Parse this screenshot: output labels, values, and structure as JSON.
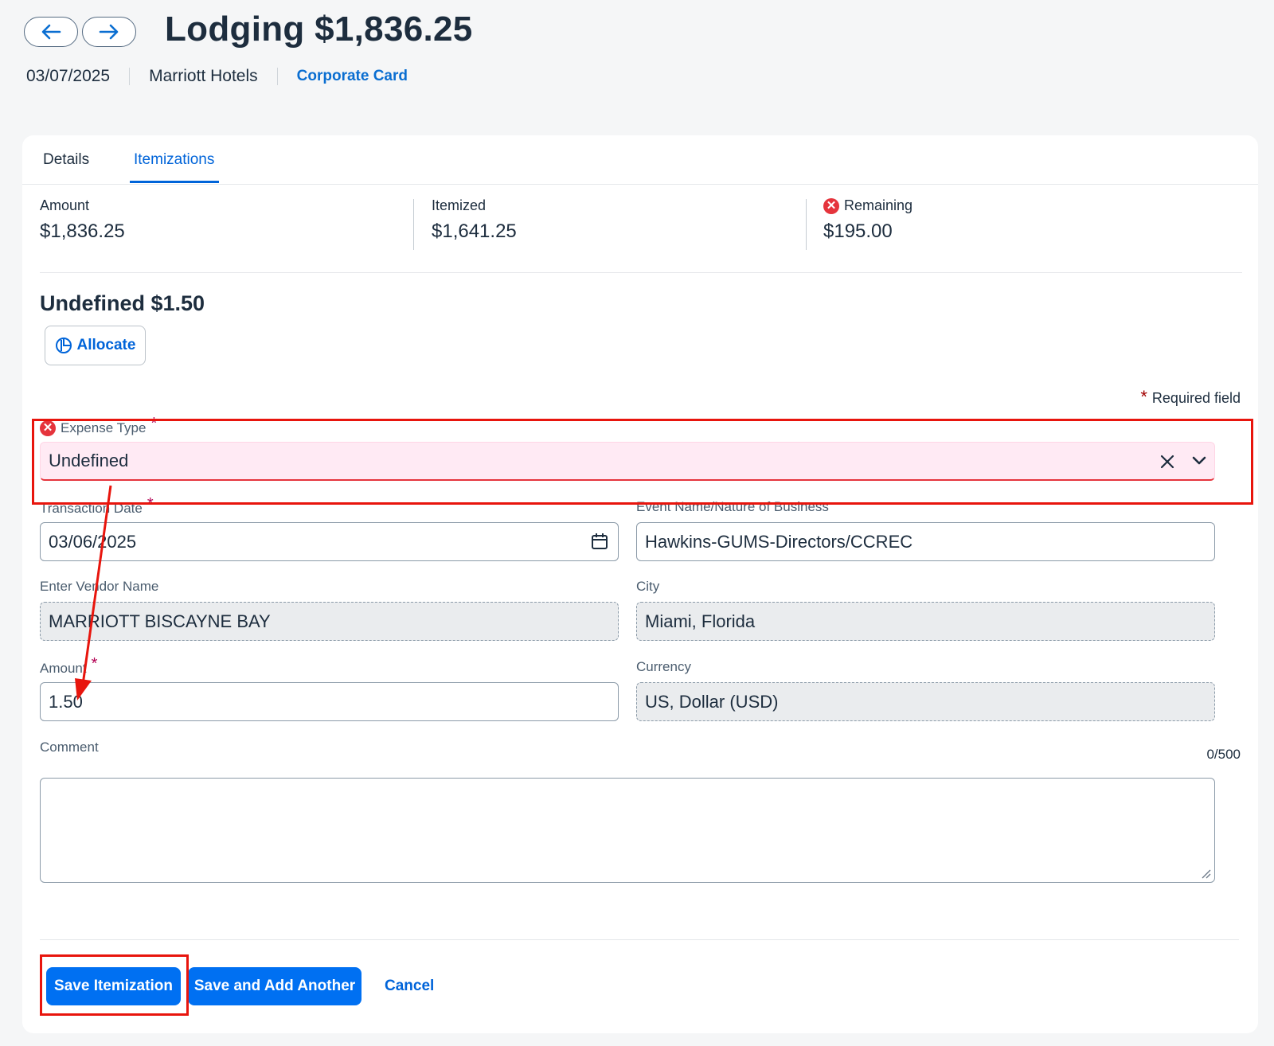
{
  "header": {
    "title": "Lodging $1,836.25",
    "date": "03/07/2025",
    "vendor": "Marriott Hotels",
    "payment_link": "Corporate Card"
  },
  "tabs": [
    {
      "label": "Details",
      "active": false
    },
    {
      "label": "Itemizations",
      "active": true
    }
  ],
  "summary": {
    "amount_label": "Amount",
    "amount_value": "$1,836.25",
    "itemized_label": "Itemized",
    "itemized_value": "$1,641.25",
    "remaining_label": "Remaining",
    "remaining_value": "$195.00"
  },
  "itemization": {
    "title": "Undefined $1.50",
    "allocate_label": "Allocate",
    "required_note": "Required field"
  },
  "fields": {
    "expense_type": {
      "label": "Expense Type",
      "value": "Undefined",
      "required": true,
      "error": true
    },
    "transaction_date": {
      "label": "Transaction Date",
      "value": "03/06/2025",
      "required": true
    },
    "event_name": {
      "label": "Event Name/Nature of Business",
      "value": "Hawkins-GUMS-Directors/CCREC"
    },
    "vendor_name": {
      "label": "Enter Vendor Name",
      "value": "MARRIOTT BISCAYNE BAY",
      "readonly": true
    },
    "city": {
      "label": "City",
      "value": "Miami, Florida",
      "readonly": true
    },
    "amount": {
      "label": "Amount",
      "value": "1.50",
      "required": true
    },
    "currency": {
      "label": "Currency",
      "value": "US, Dollar (USD)",
      "readonly": true
    },
    "comment": {
      "label": "Comment",
      "value": "",
      "counter": "0/500"
    }
  },
  "actions": {
    "save_label": "Save Itemization",
    "save_add_label": "Save and Add Another",
    "cancel_label": "Cancel"
  },
  "colors": {
    "primary": "#0070f2",
    "link": "#0064d9",
    "error": "#e5343c",
    "annotation": "#e8150d"
  }
}
